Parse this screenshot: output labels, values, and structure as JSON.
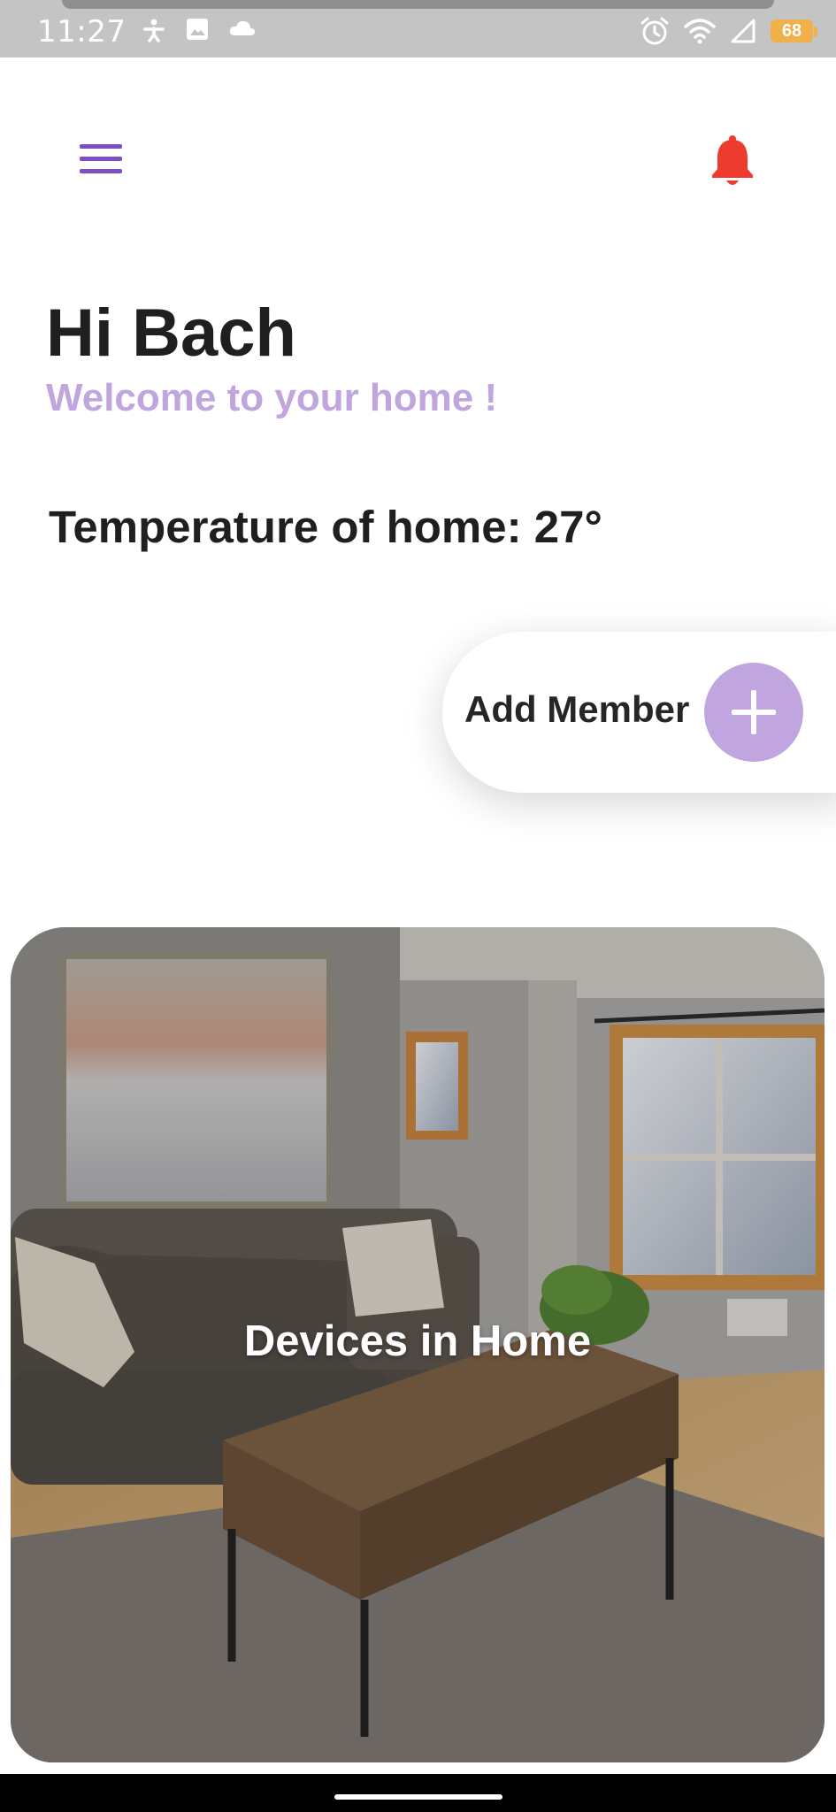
{
  "status_bar": {
    "time": "11:27",
    "battery_level": "68",
    "left_icons": [
      "accessibility-icon",
      "image-icon",
      "cloud-icon"
    ],
    "right_icons": [
      "alarm-icon",
      "wifi-icon",
      "cell-signal-icon",
      "battery-icon"
    ]
  },
  "header": {
    "menu_icon": "menu-icon",
    "notification_icon": "bell-icon"
  },
  "greeting": {
    "title": "Hi Bach",
    "subtitle": "Welcome to your home !"
  },
  "temperature": {
    "text": "Temperature of home: 27°"
  },
  "add_member": {
    "label": "Add Member",
    "icon": "plus-icon"
  },
  "devices_card": {
    "label": "Devices in Home",
    "image": "living-room-photo"
  },
  "colors": {
    "accent_purple": "#7b4fc0",
    "light_purple": "#c0a5df",
    "bell_red": "#ee3b2f",
    "text_dark": "#1f1f1f",
    "status_bar": "#c4c4c4",
    "battery": "#f0b04a"
  }
}
